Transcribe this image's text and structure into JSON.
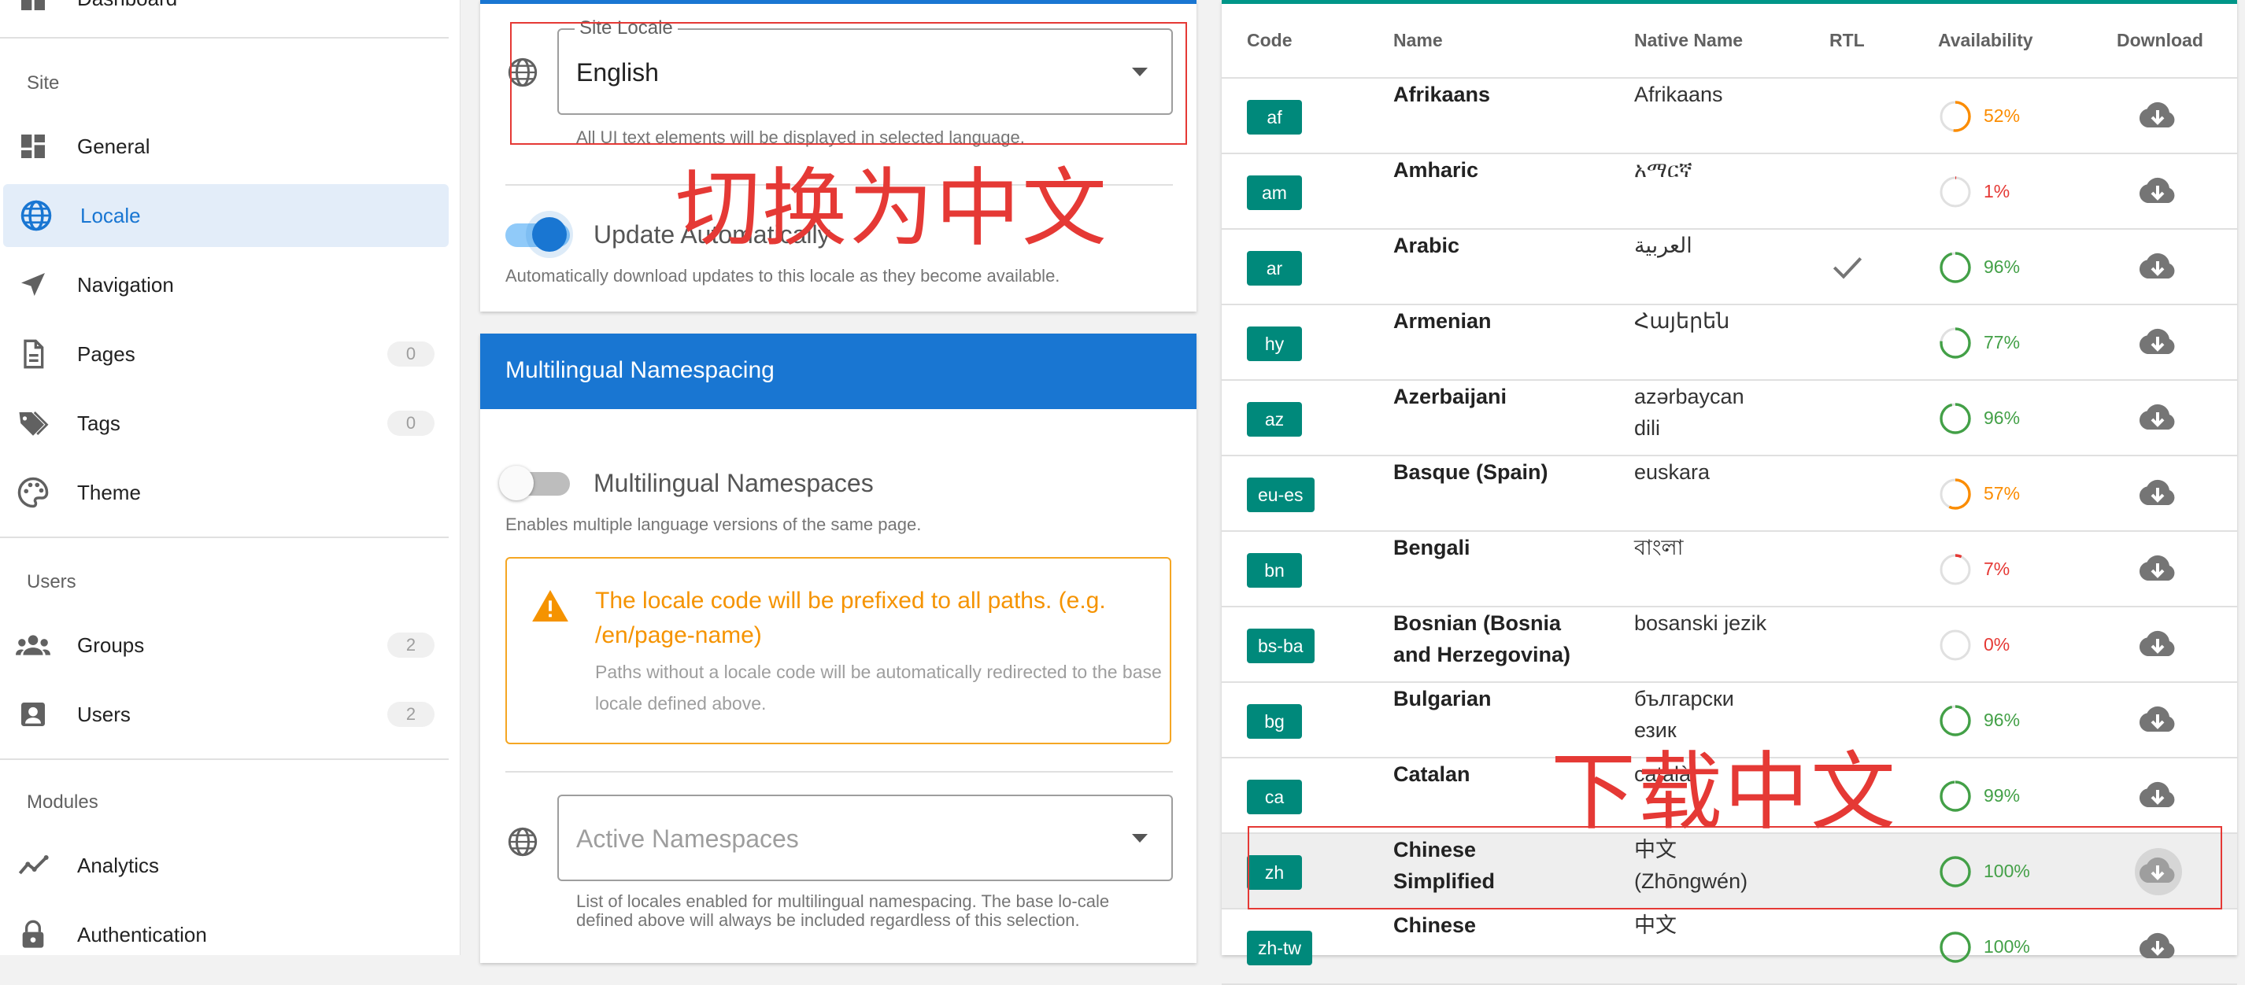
{
  "sidebar": {
    "top_partial_label": "Dashboard",
    "sections": {
      "site": "Site",
      "users": "Users",
      "modules": "Modules"
    },
    "items": [
      {
        "label": "General",
        "icon": "dashboard-icon"
      },
      {
        "label": "Locale",
        "icon": "globe-icon",
        "active": true
      },
      {
        "label": "Navigation",
        "icon": "navigation-icon"
      },
      {
        "label": "Pages",
        "icon": "page-icon",
        "count": "0"
      },
      {
        "label": "Tags",
        "icon": "tags-icon",
        "count": "0"
      },
      {
        "label": "Theme",
        "icon": "palette-icon"
      },
      {
        "label": "Groups",
        "icon": "groups-icon",
        "count": "2"
      },
      {
        "label": "Users",
        "icon": "user-box-icon",
        "count": "2"
      },
      {
        "label": "Analytics",
        "icon": "analytics-icon"
      },
      {
        "label": "Authentication",
        "icon": "lock-icon"
      }
    ]
  },
  "locale_card": {
    "select_legend": "Site Locale",
    "select_value": "English",
    "select_hint": "All UI text elements will be displayed in selected language.",
    "update_toggle_label": "Update Automatically",
    "update_toggle_on": true,
    "update_hint": "Automatically download updates to this locale as they become available."
  },
  "namespacing_card": {
    "title": "Multilingual Namespacing",
    "toggle_label": "Multilingual Namespaces",
    "toggle_on": false,
    "toggle_hint": "Enables multiple language versions of the same page.",
    "alert_title": "The locale code will be prefixed to all paths. (e.g. /en/page-name)",
    "alert_body": "Paths without a locale code will be automatically redirected to the base locale defined above.",
    "namespaces_placeholder": "Active Namespaces",
    "namespaces_hint": "List of locales enabled for multilingual namespacing. The base lo-cale defined above will always be included regardless of this selection."
  },
  "annotations": {
    "switch_to_chinese": "切换为中文",
    "download_chinese": "下载中文"
  },
  "colors": {
    "primary": "#1976d2",
    "teal": "#00897b",
    "annotation_red": "#e53935",
    "warning": "#f59300",
    "avail_green": "#43a047",
    "avail_orange": "#fb8c00",
    "avail_red": "#e53935"
  },
  "table": {
    "headers": [
      "Code",
      "Name",
      "Native Name",
      "RTL",
      "Availability",
      "Download"
    ],
    "rows": [
      {
        "code": "af",
        "name": "Afrikaans",
        "native": "Afrikaans",
        "rtl": false,
        "availability": 52,
        "availability_label": "52%",
        "status": "orange"
      },
      {
        "code": "am",
        "name": "Amharic",
        "native": "አማርኛ",
        "rtl": false,
        "availability": 1,
        "availability_label": "1%",
        "status": "red"
      },
      {
        "code": "ar",
        "name": "Arabic",
        "native": "العربية",
        "rtl": true,
        "availability": 96,
        "availability_label": "96%",
        "status": "green"
      },
      {
        "code": "hy",
        "name": "Armenian",
        "native": "Հայերեն",
        "rtl": false,
        "availability": 77,
        "availability_label": "77%",
        "status": "green"
      },
      {
        "code": "az",
        "name": "Azerbaijani",
        "native": "azərbaycan dili",
        "rtl": false,
        "availability": 96,
        "availability_label": "96%",
        "status": "green"
      },
      {
        "code": "eu-es",
        "name": "Basque (Spain)",
        "native": "euskara",
        "rtl": false,
        "availability": 57,
        "availability_label": "57%",
        "status": "orange"
      },
      {
        "code": "bn",
        "name": "Bengali",
        "native": "বাংলা",
        "rtl": false,
        "availability": 7,
        "availability_label": "7%",
        "status": "red"
      },
      {
        "code": "bs-ba",
        "name": "Bosnian (Bosnia and Herzegovina)",
        "native": "bosanski jezik",
        "rtl": false,
        "availability": 0,
        "availability_label": "0%",
        "status": "red"
      },
      {
        "code": "bg",
        "name": "Bulgarian",
        "native": "български език",
        "rtl": false,
        "availability": 96,
        "availability_label": "96%",
        "status": "green"
      },
      {
        "code": "ca",
        "name": "Catalan",
        "native": "català",
        "rtl": false,
        "availability": 99,
        "availability_label": "99%",
        "status": "green"
      },
      {
        "code": "zh",
        "name": "Chinese Simplified",
        "native": "中文 (Zhōngwén)",
        "rtl": false,
        "availability": 100,
        "availability_label": "100%",
        "status": "green",
        "highlight": true
      },
      {
        "code": "zh-tw",
        "name": "Chinese",
        "native": "中文",
        "rtl": false,
        "availability": 100,
        "availability_label": "100%",
        "status": "green"
      }
    ]
  }
}
